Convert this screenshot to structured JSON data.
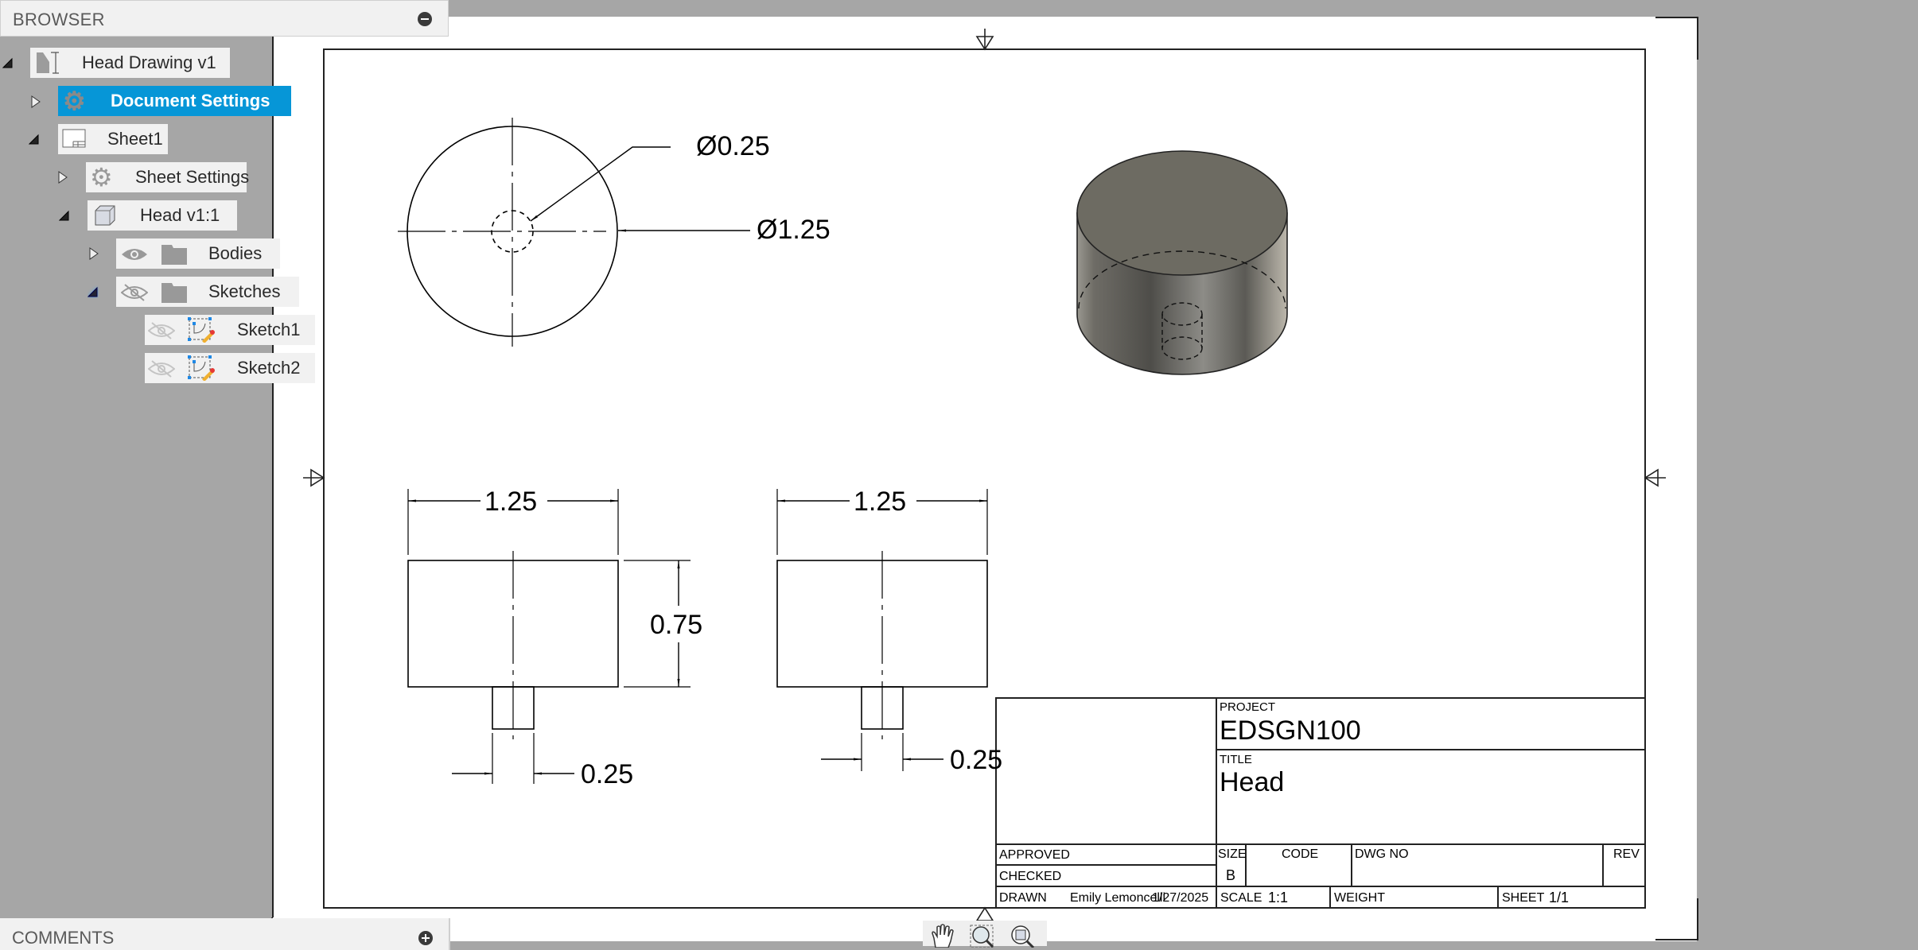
{
  "browser": {
    "title": "BROWSER",
    "tree": {
      "root": "Head Drawing v1",
      "document_settings": "Document Settings",
      "sheet": "Sheet1",
      "sheet_settings": "Sheet Settings",
      "component": "Head v1:1",
      "bodies": "Bodies",
      "sketches": "Sketches",
      "sketch1": "Sketch1",
      "sketch2": "Sketch2"
    }
  },
  "comments": {
    "title": "COMMENTS"
  },
  "colors": {
    "selected": "#0696d7",
    "panel": "#f1f1f1",
    "canvas_bg": "#a6a6a6"
  },
  "drawing": {
    "top_view": {
      "hole_dia": "Ø0.25",
      "outer_dia": "Ø1.25"
    },
    "front_view": {
      "width": "1.25",
      "height": "0.75",
      "hole": "0.25"
    },
    "side_view": {
      "width": "1.25",
      "hole": "0.25"
    }
  },
  "title_block": {
    "project_label": "PROJECT",
    "project": "EDSGN100",
    "title_label": "TITLE",
    "title": "Head",
    "approved_label": "APPROVED",
    "checked_label": "CHECKED",
    "drawn_label": "DRAWN",
    "drawn_by": "Emily Lemoncelli",
    "drawn_date": "1/27/2025",
    "size_label": "SIZE",
    "size": "B",
    "code_label": "CODE",
    "dwg_no_label": "DWG NO",
    "rev_label": "REV",
    "scale_label": "SCALE",
    "scale": "1:1",
    "weight_label": "WEIGHT",
    "sheet_label": "SHEET",
    "sheet": "1/1"
  },
  "navbar": {
    "tools": [
      "pan-icon",
      "zoom-window-icon",
      "fit-icon"
    ]
  }
}
